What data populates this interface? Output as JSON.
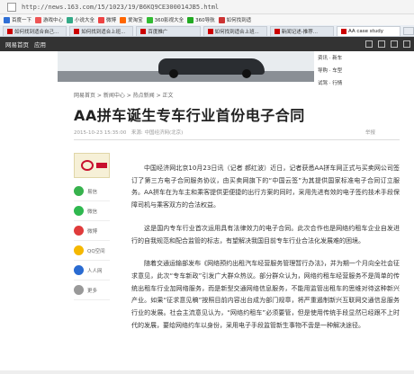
{
  "browser": {
    "url": "http://news.163.com/15/1023/19/B6KQ9CE300014JB5.html",
    "favorites": [
      {
        "label": "百度一下",
        "color": "#2f6fd6"
      },
      {
        "label": "游戏中心",
        "color": "#e55"
      },
      {
        "label": "小说大全",
        "color": "#3a8"
      },
      {
        "label": "微博",
        "color": "#e44"
      },
      {
        "label": "爱淘宝",
        "color": "#f60"
      },
      {
        "label": "360影视大全",
        "color": "#3b3"
      },
      {
        "label": "360导航",
        "color": "#2a2"
      },
      {
        "label": "如何找到适",
        "color": "#c33"
      }
    ],
    "tabs": [
      {
        "label": "如何找到适合自己...",
        "active": false
      },
      {
        "label": "如何找到适合上班...",
        "active": false
      },
      {
        "label": "百度推广",
        "active": false
      },
      {
        "label": "如何找到适合上班...",
        "active": false
      },
      {
        "label": "新闻记述-推荐...",
        "active": false
      },
      {
        "label": "AA case study",
        "active": true
      }
    ]
  },
  "site": {
    "nav_left": "网易首页",
    "nav_app": "应用"
  },
  "banner_side": [
    "资讯 · 新车",
    "导购 · 车型",
    "试驾 · 行情"
  ],
  "breadcrumb": "网易首页 > 新闻中心 > 热点新闻 > 正文",
  "article": {
    "title": "AA拼车诞生专车行业首份电子合同",
    "meta": "2015-10-23 15:35:00　来源: 中国经济网(北京)",
    "report": "举报",
    "paragraphs": [
      "中国经济网北京10月23日讯（记者 郝红波）近日，记者获悉AA拼车网正式与买卖网公司签订了第三方电子合同服务协议，由买卖网旗下的“中国云签”为其提供国家标准电子合同订立服务。AA拼车在为车主和乘客提供更便捷的出行方案的同时，采用先进有效的电子签约技术手段保障司机与乘客双方的合法权益。",
      "这是国内专车行业首次运用具有法律效力的电子合同。此次合作也是网络约租车企业自发进行的自我规范和配合监管的标志，有望解决我国目前专车行业合法化发展难的困境。",
      "随着交通运输部发布《网络预约出租汽车经营服务管理暂行办法》，并为期一个月向全社会征求意见，此次“专车新政”引发广大群众热议。部分群众认为，网络约租车经营服务不是简单的传统出租车行业加网络服务，而是新型交通网络信息服务，不能用监管出租车的思维对待这种新兴产业。如果“征求意见稿”按照目前内容出台成为部门规章，将严重遏制新兴互联网交通信息服务行业的发展。社会主流意见认为，“网络约租车”必须要管，但是使用传统手段显然已经跟不上时代的发展，要给网络约车以身份，采用电子手段监管新生事物不啻是一种解决途径。"
    ]
  },
  "share": {
    "items": [
      {
        "label": "易信",
        "color": "#37b24d"
      },
      {
        "label": "微信",
        "color": "#2fb84f"
      },
      {
        "label": "微博",
        "color": "#e03b3b"
      },
      {
        "label": "QQ空间",
        "color": "#f5b800"
      },
      {
        "label": "人人网",
        "color": "#2a6bd1"
      },
      {
        "label": "更多",
        "color": "#999"
      }
    ]
  }
}
